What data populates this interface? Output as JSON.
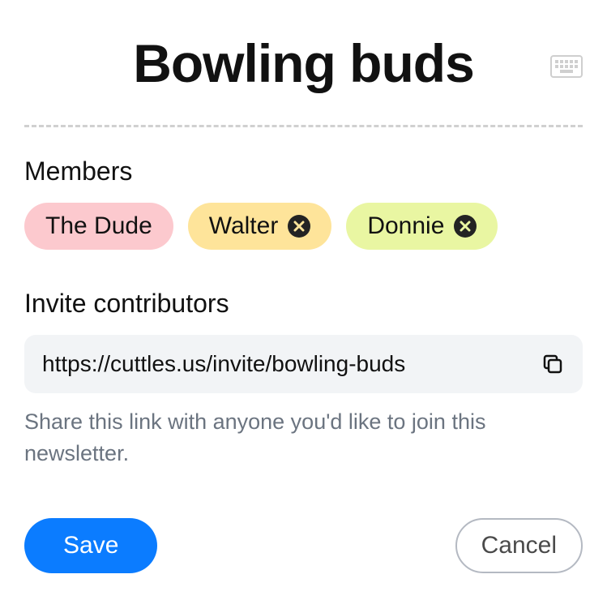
{
  "title": "Bowling buds",
  "members": {
    "label": "Members",
    "chips": [
      {
        "name": "The Dude",
        "color": "pink",
        "removable": false
      },
      {
        "name": "Walter",
        "color": "yellow",
        "removable": true
      },
      {
        "name": "Donnie",
        "color": "green",
        "removable": true
      }
    ]
  },
  "invite": {
    "label": "Invite contributors",
    "url": "https://cuttles.us/invite/bowling-buds",
    "helper": "Share this link with anyone you'd like to join this newsletter."
  },
  "actions": {
    "save": "Save",
    "cancel": "Cancel"
  }
}
